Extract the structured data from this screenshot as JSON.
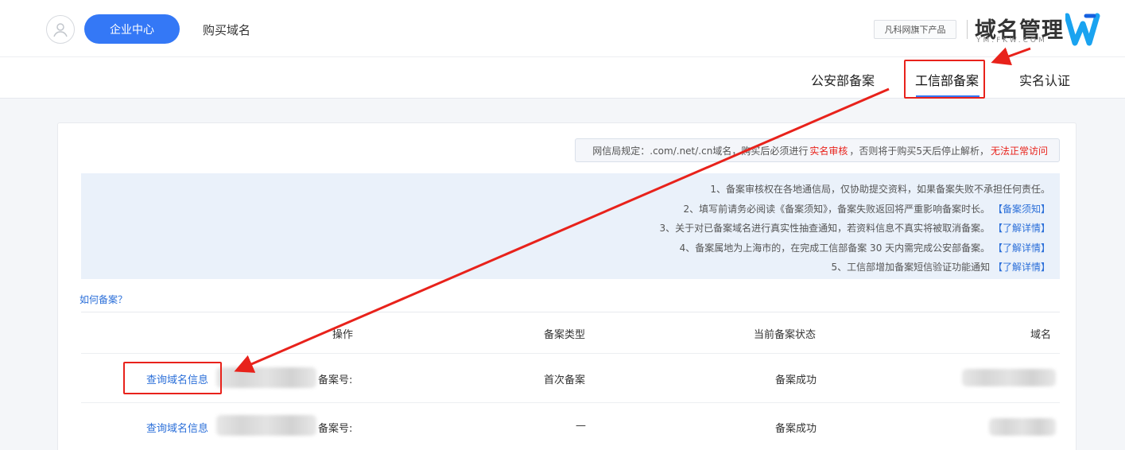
{
  "header": {
    "enterprise_button": "企业中心",
    "buy_domain_link": "购买域名",
    "brand_tag": "凡科网旗下产品",
    "brand_name": "域名管理",
    "brand_sub": "YM.FKW.COM"
  },
  "nav": {
    "items": [
      {
        "label": "实名认证"
      },
      {
        "label": "工信部备案"
      },
      {
        "label": "公安部备案"
      }
    ],
    "active_index": 1
  },
  "notice": {
    "prefix": "网信局规定：.com/.net/.cn域名，购买后必须进行",
    "highlight1": "实名审核",
    "middle": "，否则将于购买5天后停止解析，",
    "highlight2": "无法正常访问"
  },
  "tips": [
    {
      "text": "1、备案审核权在各地通信局，仅协助提交资料，如果备案失败不承担任何责任。",
      "link": ""
    },
    {
      "text": "2、填写前请务必阅读《备案须知》，备案失败返回将严重影响备案时长。",
      "link": "【备案须知】"
    },
    {
      "text": "3、关于对已备案域名进行真实性抽查通知，若资料信息不真实将被取消备案。",
      "link": "【了解详情】"
    },
    {
      "text": "4、备案属地为上海市的，在完成工信部备案 30 天内需完成公安部备案。",
      "link": "【了解详情】"
    },
    {
      "text": "5、工信部增加备案短信验证功能通知",
      "link": "【了解详情】"
    }
  ],
  "how_link": "如何备案？",
  "table": {
    "headers": {
      "domain": "域名",
      "status": "当前备案状态",
      "type": "备案类型",
      "action": "操作"
    },
    "rows": [
      {
        "status": "备案成功",
        "type": "首次备案",
        "record_label": "备案号:",
        "query": "查询域名信息"
      },
      {
        "status": "备案成功",
        "type": "—",
        "record_label": "备案号:",
        "query": "查询域名信息"
      }
    ]
  },
  "colors": {
    "primary": "#3478f6",
    "annotation": "#e8221b",
    "link": "#2b6fd9"
  }
}
